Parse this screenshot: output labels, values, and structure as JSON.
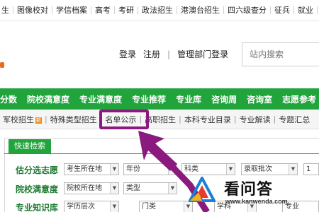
{
  "topbar": {
    "links": [
      "生",
      "图像校对",
      "学信档案",
      "高考",
      "考研",
      "政法招生",
      "港澳台招生",
      "四六级查分",
      "征兵",
      "就业",
      "学"
    ]
  },
  "header": {
    "login": "登录",
    "register": "注册",
    "divider": "|",
    "admin_login": "管理部门登录",
    "search_placeholder": "站内搜索"
  },
  "nav": {
    "items": [
      "分数",
      "院校满意度",
      "专业满意度",
      "专业推荐",
      "专业库",
      "咨询周",
      "咨询室",
      "志愿参考"
    ]
  },
  "subnav": {
    "items": [
      "军校招生",
      "特殊类型招生",
      "名单公示",
      "高职招生",
      "本科专业目录",
      "专业解读",
      "专题汇总"
    ],
    "badge": "新"
  },
  "quick_search": {
    "title": "快速检索",
    "rows": [
      {
        "label": "估分选志愿",
        "selects": [
          "考生所在地",
          "年份",
          "科类",
          "录取批次",
          "1"
        ]
      },
      {
        "label": "院校满意度",
        "selects": [
          "院校所在地",
          "类型"
        ]
      },
      {
        "label": "专业知识库",
        "selects": [
          "学历层次",
          "门类",
          "学科",
          "专业"
        ]
      }
    ]
  },
  "watermark": {
    "title": "看问答",
    "url": "www.kanwenda.com"
  },
  "colors": {
    "nav_green": "#21a43b",
    "highlight_purple": "#8a1a7e",
    "badge_orange": "#f08a1c"
  }
}
